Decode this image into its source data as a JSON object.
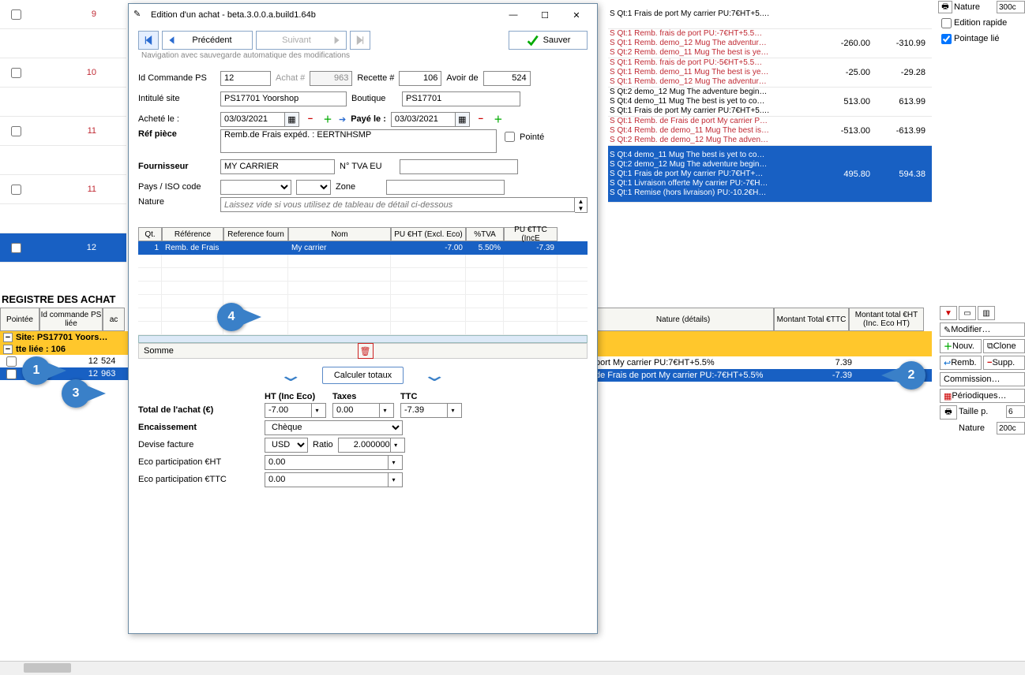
{
  "side": {
    "nature_lbl": "Nature",
    "nature_val": "300c",
    "edit_rapide": "Edition rapide",
    "pointage": "Pointage lié"
  },
  "bg_rows": [
    {
      "num": "9"
    },
    {
      "num": ""
    },
    {
      "num": "10"
    },
    {
      "num": ""
    },
    {
      "num": "11"
    },
    {
      "num": ""
    },
    {
      "num": "11"
    },
    {
      "num": ""
    },
    {
      "num": "12",
      "hl": true
    }
  ],
  "right_rows": [
    {
      "red": false,
      "lines": "S  Qt:1  Frais de port   My carrier  PU:7€HT+5.…",
      "c1": "",
      "c2": ""
    },
    {
      "red": true,
      "lines": "S  Qt:1  Remb. frais de port    PU:-7€HT+5.5…\nS  Qt:1  Remb. demo_12  Mug The adventur…\nS  Qt:2  Remb. demo_11  Mug The best is ye…",
      "c1": "-260.00",
      "c2": "-310.99"
    },
    {
      "red": true,
      "lines": "S  Qt:1  Remb. frais de port    PU:-5€HT+5.5…\nS  Qt:1  Remb. demo_11  Mug The best is ye…\nS  Qt:1  Remb. demo_12  Mug The adventur…",
      "c1": "-25.00",
      "c2": "-29.28"
    },
    {
      "red": false,
      "lines": "S  Qt:2  demo_12  Mug The adventure begin…\nS  Qt:4  demo_11  Mug The best is yet to co…\nS  Qt:1  Frais de port   My carrier  PU:7€HT+5.…",
      "c1": "513.00",
      "c2": "613.99"
    },
    {
      "red": true,
      "lines": "S  Qt:1  Remb. de Frais de port   My carrier  P…\nS  Qt:4  Remb. de demo_11  Mug The best is…\nS  Qt:2  Remb. de demo_12  Mug The adven…",
      "c1": "-513.00",
      "c2": "-613.99"
    },
    {
      "red": false,
      "hl": true,
      "lines": "S  Qt:4  demo_11  Mug The best is yet to co…\nS  Qt:2  demo_12  Mug The adventure begin…\nS  Qt:1  Frais de port   My carrier  PU:7€HT+…\nS  Qt:1  Livraison offerte   My carrier  PU:-7€H…\nS  Qt:1  Remise (hors livraison)    PU:-10.2€H…",
      "c1": "495.80",
      "c2": "594.38"
    }
  ],
  "section_title": "REGISTRE DES ACHAT",
  "reg_hdr": {
    "a": "Pointée",
    "b": "Id commande PS  liée",
    "c": "ac"
  },
  "reg_site": "Site:  PS17701 Yoors…",
  "reg_rec": "tte liée : 106",
  "reg_rows": [
    {
      "a": "12",
      "b": "524"
    },
    {
      "a": "12",
      "b": "963",
      "sel": true
    }
  ],
  "reg_mid_hdr": {
    "a": "Nature (détails)",
    "b": "Montant Total €TTC",
    "c": "Montant total €HT (Inc. Eco HT)"
  },
  "reg_mid_rows": [
    {
      "a": "port   My carrier  PU:7€HT+5.5%",
      "b": "7.39",
      "c": ""
    },
    {
      "a": "de Frais de port   My carrier  PU:-7€HT+5.5%",
      "b": "-7.39",
      "c": "",
      "sel": true
    }
  ],
  "actions": {
    "modifier": "Modifier…",
    "nouv": "Nouv.",
    "clone": "Clone",
    "remb": "Remb.",
    "supp": "Supp.",
    "commission": "Commission…",
    "period": "Périodiques…",
    "taillep": "Taille p.",
    "taillev": "6",
    "nature": "Nature",
    "naturev": "200c"
  },
  "dlg_title": "Edition d'un achat - beta.3.0.0.a.build1.64b",
  "nav": {
    "prev": "Précédent",
    "next": "Suivant",
    "save": "Sauver",
    "sub": "Navigation avec sauvegarde automatique des modifications"
  },
  "f": {
    "idcmd_l": "Id Commande PS",
    "idcmd": "12",
    "achatn_l": "Achat #",
    "achatn": "963",
    "recette_l": "Recette #",
    "recette": "106",
    "avoir_l": "Avoir de",
    "avoir": "524",
    "site_l": "Intitulé site",
    "site": "PS17701 Yoorshop",
    "boutique_l": "Boutique",
    "boutique": "PS17701",
    "achete_l": "Acheté le :",
    "d1": "03/03/2021",
    "paye_l": "Payé le :",
    "d2": "03/03/2021",
    "ref_l": "Réf pièce",
    "ref": "Remb.de Frais expéd. : EERTNHSMP",
    "pointe": "Pointé",
    "fourn_l": "Fournisseur",
    "fourn": "MY CARRIER",
    "tva_l": "N° TVA EU",
    "pays_l": "Pays / ISO code",
    "zone_l": "Zone",
    "nature_l": "Nature",
    "nature_ph": "Laissez vide si vous utilisez de tableau de détail ci-dessous"
  },
  "gridh": {
    "qt": "Qt.",
    "ref": "Référence",
    "reff": "Reference fourn",
    "nom": "Nom",
    "pu": "PU €HT (Excl. Eco)",
    "tva": "%TVA",
    "ttc": "PU €TTC (IncE"
  },
  "gridr": {
    "qt": "1",
    "ref": "Remb. de Frais",
    "reff": "",
    "nom": "My carrier",
    "pu": "-7.00",
    "tva": "5.50%",
    "ttc": "-7.39"
  },
  "gfoot": "Somme",
  "calc": "Calculer totaux",
  "toth": {
    "a": "HT (Inc Eco)",
    "b": "Taxes",
    "c": "TTC"
  },
  "tot": {
    "lbl": "Total de l'achat (€)",
    "a": "-7.00",
    "b": "0.00",
    "c": "-7.39"
  },
  "enc": {
    "lbl": "Encaissement",
    "v": "Chèque"
  },
  "dev": {
    "lbl": "Devise facture",
    "v": "USD",
    "rlbl": "Ratio",
    "rv": "2.000000"
  },
  "eco1": {
    "lbl": "Eco participation €HT",
    "v": "0.00"
  },
  "eco2": {
    "lbl": "Eco participation €TTC",
    "v": "0.00"
  }
}
